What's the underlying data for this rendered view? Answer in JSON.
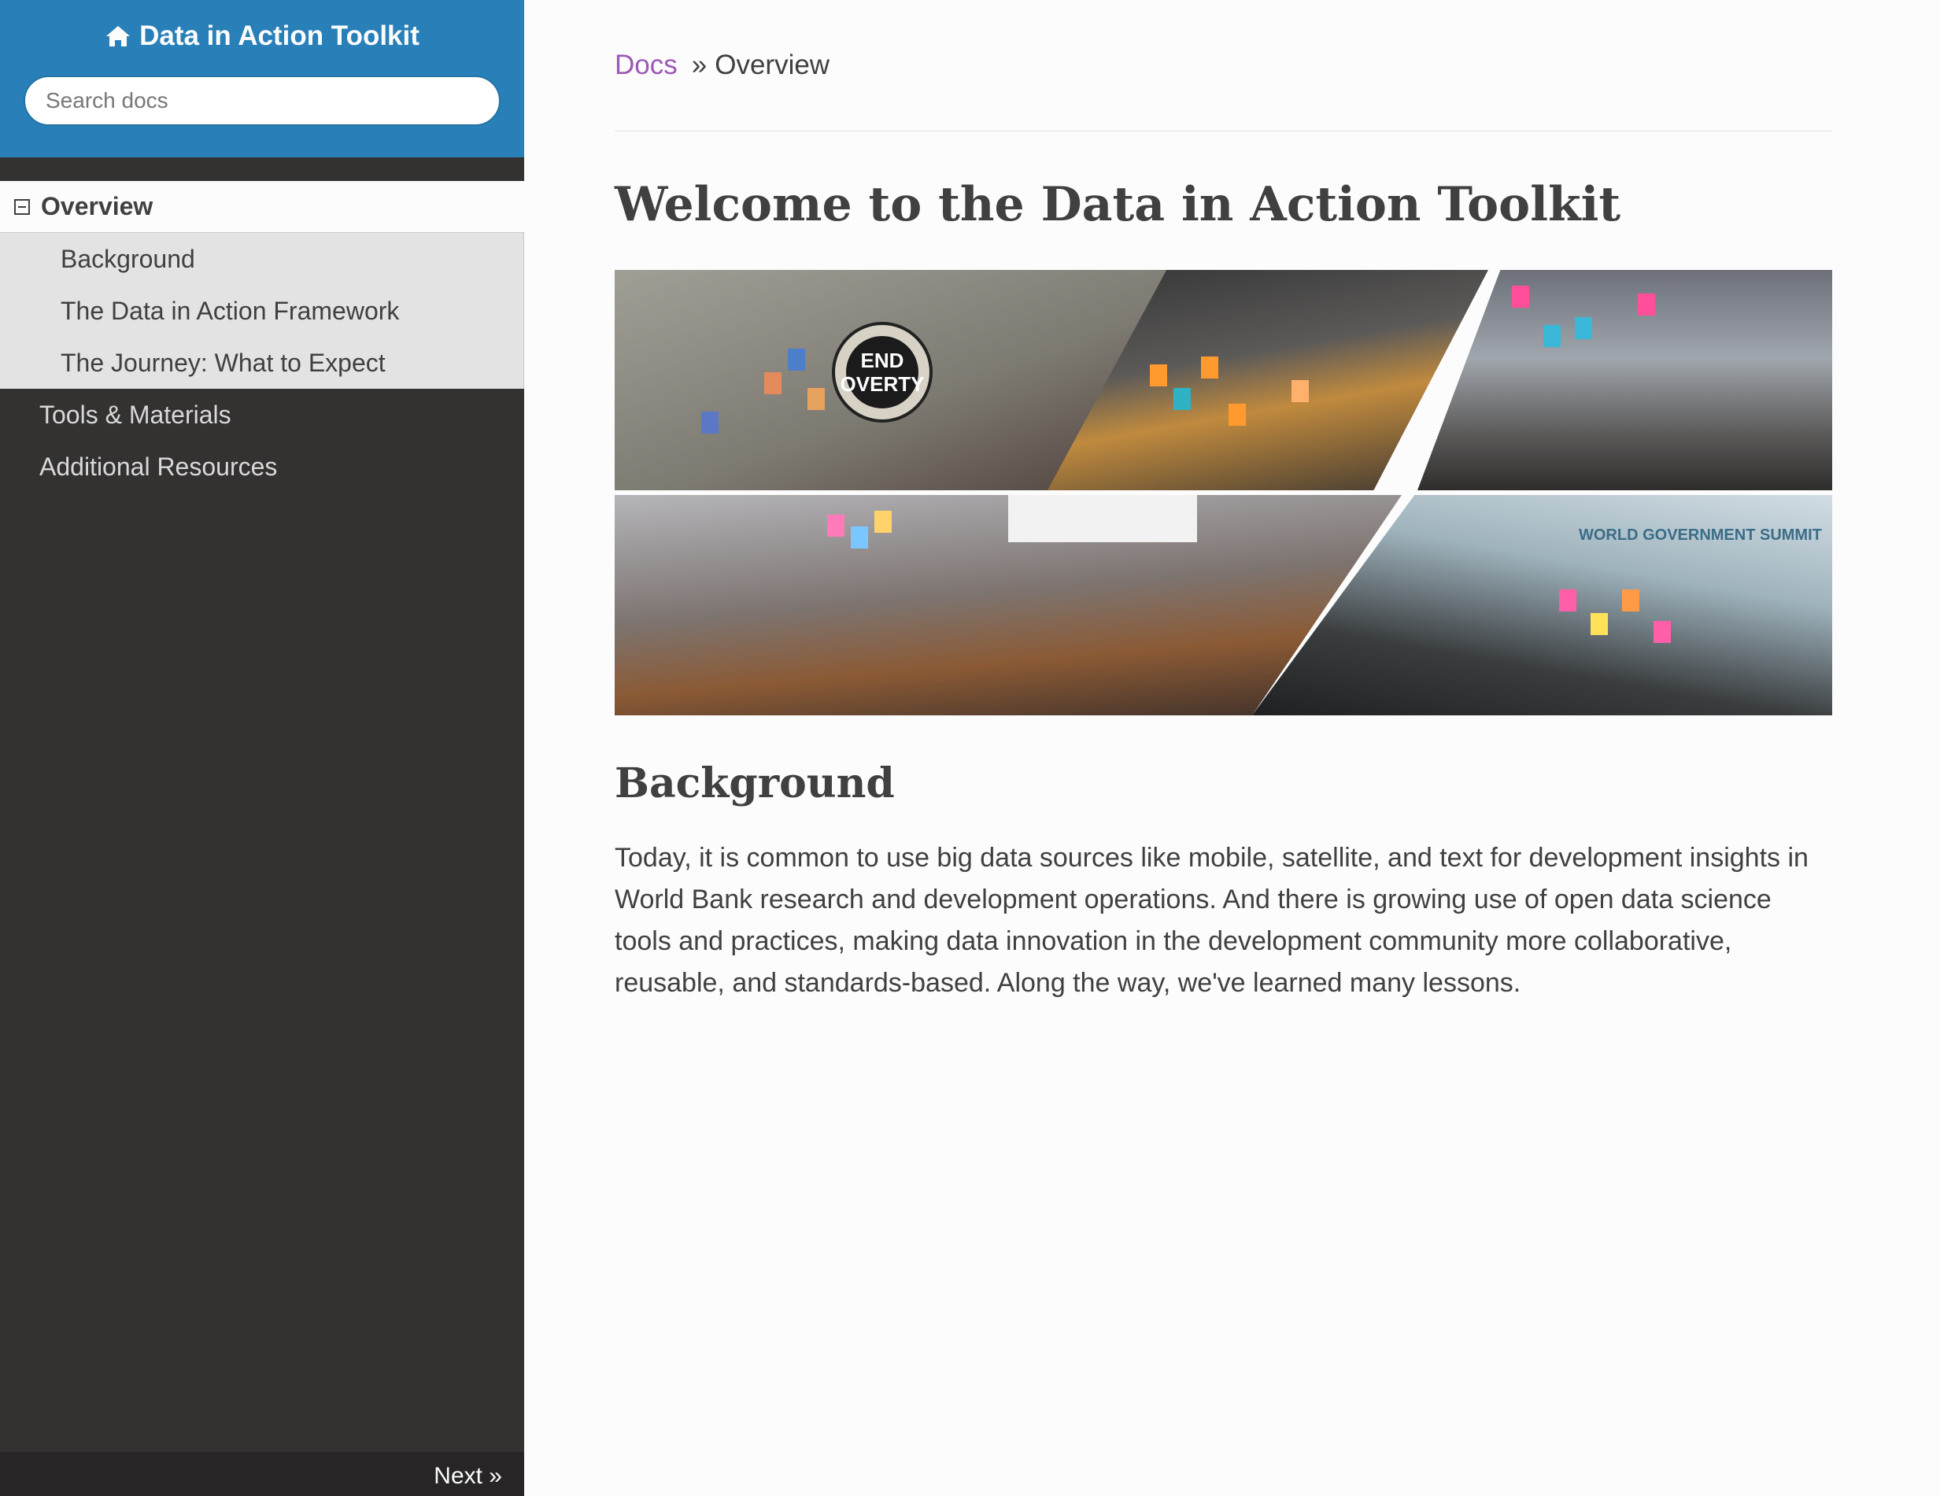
{
  "sidebar": {
    "brand": "Data in Action Toolkit",
    "search_placeholder": "Search docs",
    "current": "Overview",
    "subitems": [
      "Background",
      "The Data in Action Framework",
      "The Journey: What to Expect"
    ],
    "items": [
      "Tools & Materials",
      "Additional Resources"
    ],
    "next_label": "Next »"
  },
  "breadcrumb": {
    "docs": "Docs",
    "separator": "»",
    "current": "Overview"
  },
  "main": {
    "title": "Welcome to the Data in Action Toolkit",
    "collage": {
      "sign_text": "END\nOVERTY",
      "banner_text": "WORLD GOVERNMENT SUMMIT"
    },
    "section_heading": "Background",
    "paragraph": "Today, it is common to use big data sources like mobile, satellite, and text for development insights in World Bank research and development operations. And there is growing use of open data science tools and practices, making data innovation in the development community more collaborative, reusable, and standards-based. Along the way, we've learned many lessons."
  },
  "colors": {
    "sidebar_bg": "#343131",
    "sidebar_top": "#2980b9",
    "link_purple": "#9b59b6",
    "text": "#404040"
  }
}
